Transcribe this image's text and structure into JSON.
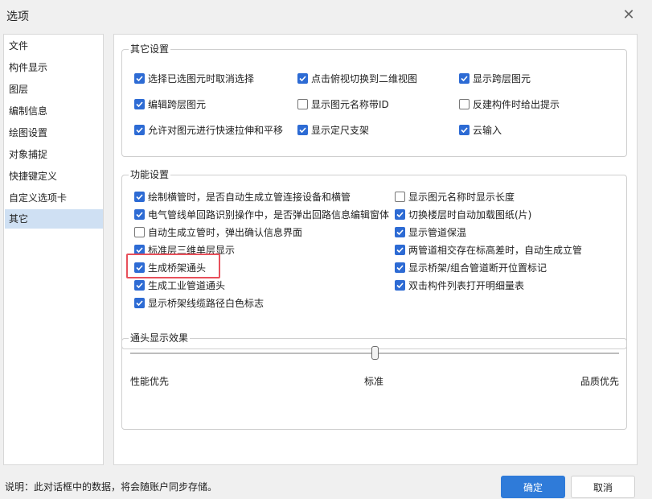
{
  "dialog": {
    "title": "选项",
    "close_icon": "close-icon"
  },
  "sidebar": {
    "items": [
      {
        "label": "文件"
      },
      {
        "label": "构件显示"
      },
      {
        "label": "图层"
      },
      {
        "label": "编制信息"
      },
      {
        "label": "绘图设置"
      },
      {
        "label": "对象捕捉"
      },
      {
        "label": "快捷键定义"
      },
      {
        "label": "自定义选项卡"
      },
      {
        "label": "其它",
        "selected": true
      }
    ]
  },
  "other_settings": {
    "title": "其它设置",
    "options": [
      {
        "label": "选择已选图元时取消选择",
        "checked": true
      },
      {
        "label": "点击俯视切换到二维视图",
        "checked": true
      },
      {
        "label": "显示跨层图元",
        "checked": true
      },
      {
        "label": "编辑跨层图元",
        "checked": true
      },
      {
        "label": "显示图元名称带ID",
        "checked": false
      },
      {
        "label": "反建构件时给出提示",
        "checked": false
      },
      {
        "label": "允许对图元进行快速拉伸和平移",
        "checked": true
      },
      {
        "label": "显示定尺支架",
        "checked": true
      },
      {
        "label": "云输入",
        "checked": true
      }
    ]
  },
  "function_settings": {
    "title": "功能设置",
    "left": [
      {
        "label": "绘制横管时，是否自动生成立管连接设备和横管",
        "checked": true
      },
      {
        "label": "电气管线单回路识别操作中，是否弹出回路信息编辑窗体",
        "checked": true
      },
      {
        "label": "自动生成立管时，弹出确认信息界面",
        "checked": false
      },
      {
        "label": "标准层三维单层显示",
        "checked": true
      },
      {
        "label": "生成桥架通头",
        "checked": true
      },
      {
        "label": "生成工业管道通头",
        "checked": true
      },
      {
        "label": "显示桥架线缆路径白色标志",
        "checked": true
      }
    ],
    "right": [
      {
        "label": "显示图元名称时显示长度",
        "checked": false
      },
      {
        "label": "切换楼层时自动加载图纸(片)",
        "checked": true
      },
      {
        "label": "显示管道保温",
        "checked": true
      },
      {
        "label": "两管道相交存在标高差时，自动生成立管",
        "checked": true
      },
      {
        "label": "显示桥架/组合管道断开位置标记",
        "checked": true
      },
      {
        "label": "双击构件列表打开明细量表",
        "checked": true
      }
    ]
  },
  "tee_display": {
    "title": "通头显示效果",
    "labels": [
      "性能优先",
      "标准",
      "品质优先"
    ],
    "value_fraction": 0.5
  },
  "footer": {
    "note": "说明：此对话框中的数据，将会随账户同步存储。",
    "ok": "确定",
    "cancel": "取消"
  },
  "colors": {
    "accent": "#2d6bd4",
    "highlight": "#e8505b",
    "selected_bg": "#cfe0f3"
  }
}
